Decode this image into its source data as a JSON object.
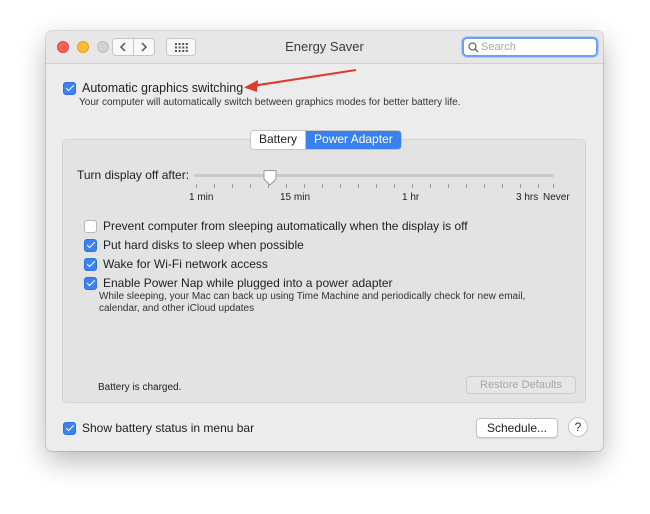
{
  "window": {
    "title": "Energy Saver"
  },
  "search": {
    "placeholder": "Search",
    "value": ""
  },
  "top": {
    "auto_graphics": {
      "label": "Automatic graphics switching",
      "checked": true
    },
    "auto_graphics_desc": "Your computer will automatically switch between graphics modes for better battery life."
  },
  "tabs": [
    {
      "label": "Battery",
      "active": false
    },
    {
      "label": "Power Adapter",
      "active": true
    }
  ],
  "display_off": {
    "label": "Turn display off after:",
    "ticks": [
      "1 min",
      "15 min",
      "1 hr",
      "3 hrs",
      "Never"
    ],
    "value": "15 min"
  },
  "options": [
    {
      "label": "Prevent computer from sleeping automatically when the display is off",
      "checked": false
    },
    {
      "label": "Put hard disks to sleep when possible",
      "checked": true
    },
    {
      "label": "Wake for Wi-Fi network access",
      "checked": true
    },
    {
      "label": "Enable Power Nap while plugged into a power adapter",
      "checked": true
    }
  ],
  "power_nap_desc": "While sleeping, your Mac can back up using Time Machine and periodically check for new email, calendar, and other iCloud updates",
  "battery_status": "Battery is charged.",
  "restore_defaults": "Restore Defaults",
  "show_status": {
    "label": "Show battery status in menu bar",
    "checked": true
  },
  "schedule_button": "Schedule...",
  "help_button": "?",
  "colors": {
    "accent": "#3a80ef",
    "annotation_arrow": "#e0392b"
  }
}
